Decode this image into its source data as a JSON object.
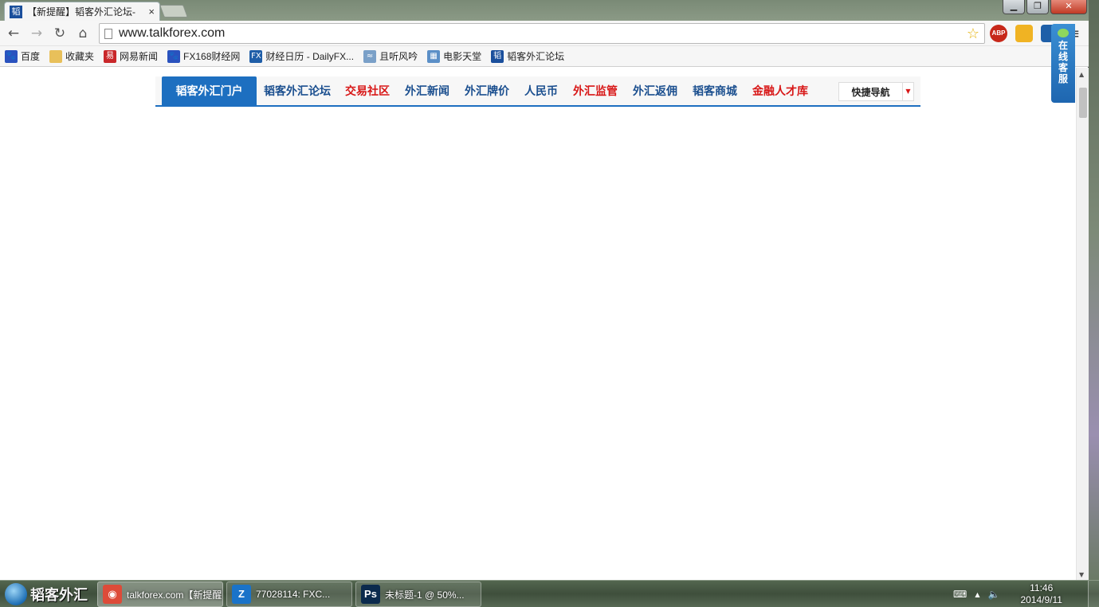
{
  "browser": {
    "tab": {
      "title": "【新提醒】韬客外汇论坛-",
      "favicon_char": "韬",
      "close": "×"
    },
    "url": "www.talkforex.com",
    "window_controls": {
      "minimize": "▁",
      "restore": "❐",
      "close": "✕"
    },
    "nav": {
      "back": "←",
      "forward": "→",
      "reload": "↻",
      "home": "⌂"
    },
    "extensions": {
      "abp": "ABP"
    },
    "menu": "≡"
  },
  "bookmarks": [
    {
      "label": "百度",
      "icon": "paw-icon",
      "color": "#2a52be",
      "glyph": "🐾"
    },
    {
      "label": "收藏夹",
      "icon": "folder-icon",
      "color": "#e8c05a",
      "glyph": ""
    },
    {
      "label": "网易新闻",
      "icon": "netease-icon",
      "color": "#c9272a",
      "glyph": "易"
    },
    {
      "label": "FX168财经网",
      "icon": "paw-icon",
      "color": "#2a52be",
      "glyph": "🐾"
    },
    {
      "label": "财经日历 - DailyFX...",
      "icon": "fx-icon",
      "color": "#1f5ea8",
      "glyph": "FX"
    },
    {
      "label": "且听风吟",
      "icon": "wind-icon",
      "color": "#7aa0c8",
      "glyph": "≈"
    },
    {
      "label": "电影天堂",
      "icon": "film-icon",
      "color": "#5b8fc7",
      "glyph": "▦"
    },
    {
      "label": "韬客外汇论坛",
      "icon": "talkforex-icon",
      "color": "#1a4f9c",
      "glyph": "韬"
    }
  ],
  "site_nav": {
    "items": [
      {
        "label": "韬客外汇门户",
        "style": "active"
      },
      {
        "label": "韬客外汇论坛",
        "style": "blue"
      },
      {
        "label": "交易社区",
        "style": "red"
      },
      {
        "label": "外汇新闻",
        "style": "blue"
      },
      {
        "label": "外汇牌价",
        "style": "blue"
      },
      {
        "label": "人民币",
        "style": "blue"
      },
      {
        "label": "外汇监管",
        "style": "red"
      },
      {
        "label": "外汇返佣",
        "style": "blue"
      },
      {
        "label": "韬客商城",
        "style": "blue"
      },
      {
        "label": "金融人才库",
        "style": "red"
      }
    ],
    "quick_nav": "快捷导航",
    "quick_nav_caret": "▼"
  },
  "customer_service": "在线客服",
  "taskbar": {
    "start_text": "韬客外汇",
    "items": [
      {
        "label": "talkforex.com【新提醒】韬客...",
        "icon": "chrome-icon",
        "color": "#dd4b39",
        "glyph": "◉"
      },
      {
        "label": "77028114: FXC...",
        "icon": "z-app-icon",
        "color": "#1a73c9",
        "glyph": "Z"
      },
      {
        "label": "未标题-1 @ 50%...",
        "icon": "photoshop-icon",
        "color": "#0b2a4d",
        "glyph": "Ps"
      }
    ],
    "tray": {
      "keyboard": "⌨",
      "arrow": "▲",
      "volume": "🔈"
    },
    "clock": {
      "time": "11:46",
      "date": "2014/9/11"
    }
  },
  "colors": {
    "accent": "#1d6fc0",
    "red_link": "#d81717",
    "blue_link": "#1b4f8f"
  }
}
